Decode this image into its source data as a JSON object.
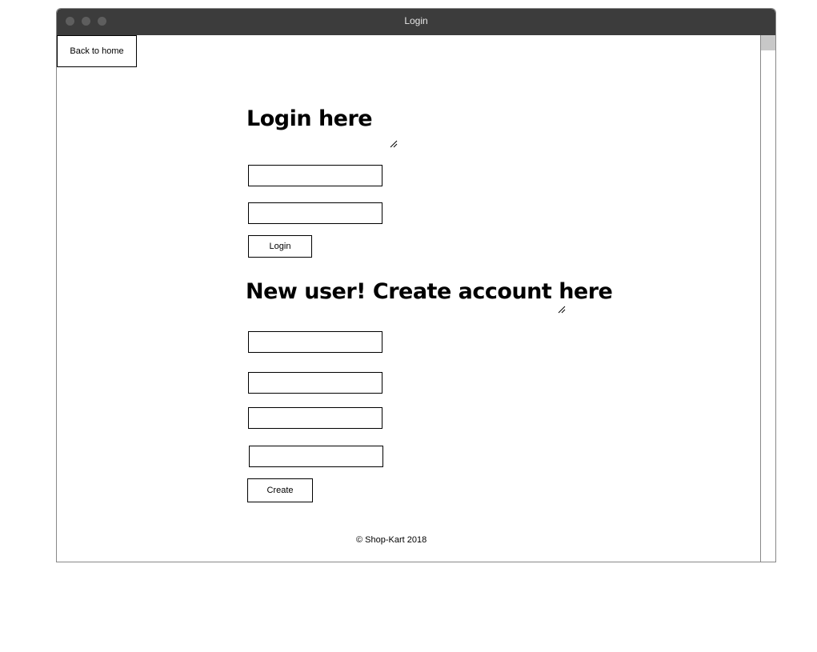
{
  "window": {
    "title": "Login"
  },
  "nav": {
    "back_label": "Back to home"
  },
  "login": {
    "heading": "Login here",
    "fields": [
      {
        "value": "",
        "placeholder": ""
      },
      {
        "value": "",
        "placeholder": ""
      }
    ],
    "button_label": "Login"
  },
  "signup": {
    "heading": "New user! Create account here",
    "fields": [
      {
        "value": "",
        "placeholder": ""
      },
      {
        "value": "",
        "placeholder": ""
      },
      {
        "value": "",
        "placeholder": ""
      },
      {
        "value": "",
        "placeholder": ""
      }
    ],
    "button_label": "Create"
  },
  "footer": {
    "copyright": "© Shop-Kart 2018"
  },
  "colors": {
    "titlebar": "#3c3c3c",
    "scroll_thumb": "#c8c8c8"
  },
  "icons": [
    "resize-grip-icon",
    "window-control-icon"
  ]
}
